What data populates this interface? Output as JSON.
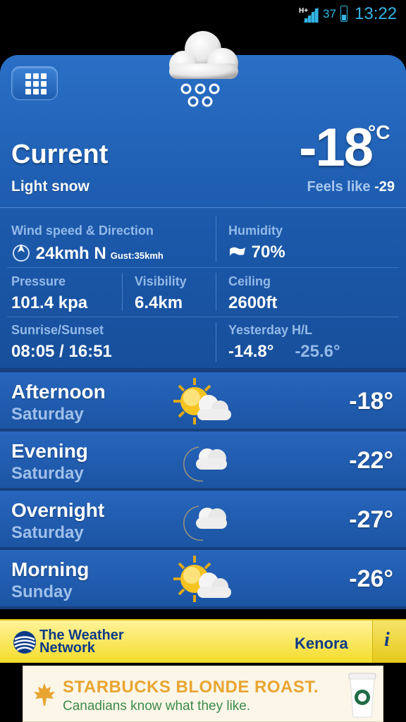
{
  "status_bar": {
    "network": "H+",
    "battery_level": "37",
    "time": "13:22"
  },
  "current": {
    "label": "Current",
    "condition": "Light snow",
    "temperature": "-18",
    "unit": "°C",
    "feels_like_label": "Feels like",
    "feels_like_value": "-29",
    "icon": "snow-cloud-icon"
  },
  "details": {
    "wind": {
      "label": "Wind speed & Direction",
      "value": "24kmh N",
      "gust": "Gust:35kmh"
    },
    "humidity": {
      "label": "Humidity",
      "value": "70%"
    },
    "pressure": {
      "label": "Pressure",
      "value": "101.4 kpa"
    },
    "visibility": {
      "label": "Visibility",
      "value": "6.4km"
    },
    "ceiling": {
      "label": "Ceiling",
      "value": "2600ft"
    },
    "sun": {
      "label": "Sunrise/Sunset",
      "value": "08:05 / 16:51"
    },
    "yesterday": {
      "label": "Yesterday H/L",
      "high": "-14.8°",
      "low": "-25.6°"
    }
  },
  "forecast": [
    {
      "period": "Afternoon",
      "day": "Saturday",
      "temp": "-18°",
      "icon": "sun-cloud-icon"
    },
    {
      "period": "Evening",
      "day": "Saturday",
      "temp": "-22°",
      "icon": "moon-cloud-icon"
    },
    {
      "period": "Overnight",
      "day": "Saturday",
      "temp": "-27°",
      "icon": "moon-cloud-icon"
    },
    {
      "period": "Morning",
      "day": "Sunday",
      "temp": "-26°",
      "icon": "sun-cloud-icon"
    }
  ],
  "footer": {
    "brand_line1": "The Weather",
    "brand_line2": "Network",
    "city": "Kenora",
    "info": "i"
  },
  "ad": {
    "headline": "STARBUCKS BLONDE ROAST.",
    "tagline": "Canadians know what they like."
  },
  "colors": {
    "card_blue": "#1f5fb3",
    "label_blue": "#93b9e8",
    "footer_yellow": "#f4dc2a",
    "brand_navy": "#0b3a86",
    "status_cyan": "#33b5e5"
  }
}
